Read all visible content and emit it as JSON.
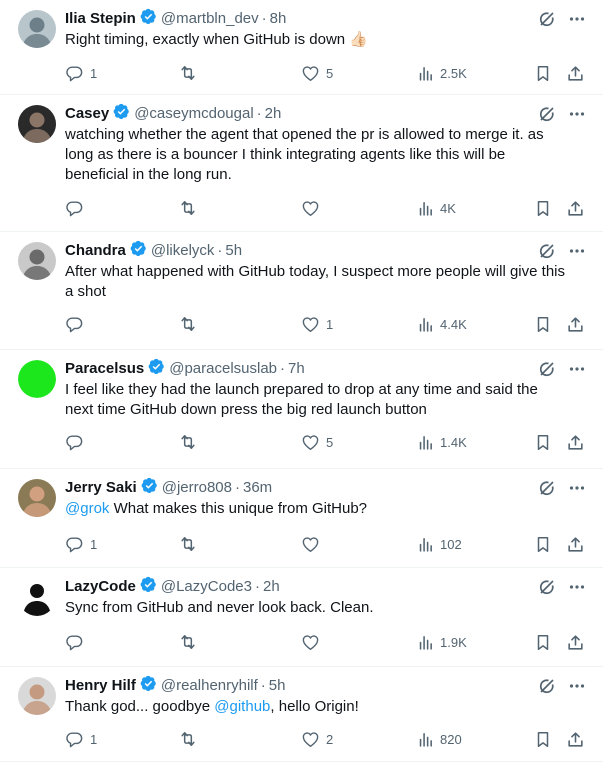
{
  "tweets": [
    {
      "name": "Ilia Stepin",
      "handle": "@martbln_dev",
      "time": "8h",
      "segments": [
        {
          "t": "Right timing, exactly when GitHub is down "
        }
      ],
      "emoji": "👍🏻",
      "replies": "1",
      "retweets": "",
      "likes": "5",
      "views": "2.5K",
      "avatar": {
        "bg": "#b8c6cc",
        "fg": "#6d7f88"
      }
    },
    {
      "name": "Casey",
      "handle": "@caseymcdougal",
      "time": "2h",
      "segments": [
        {
          "t": "watching whether the agent that opened the pr is allowed to merge it. as long as there is a bouncer I think integrating agents like this will be beneficial in the long run."
        }
      ],
      "replies": "",
      "retweets": "",
      "likes": "",
      "views": "4K",
      "avatar": {
        "bg": "#2a2a2a",
        "fg": "#8a7566"
      }
    },
    {
      "name": "Chandra",
      "handle": "@likelyck",
      "time": "5h",
      "segments": [
        {
          "t": "After what happened with GitHub today, I suspect more people will give this a shot"
        }
      ],
      "replies": "",
      "retweets": "",
      "likes": "1",
      "views": "4.4K",
      "avatar": {
        "bg": "#c9c9c9",
        "fg": "#6a6a6a"
      }
    },
    {
      "name": "Paracelsus",
      "handle": "@paracelsuslab",
      "time": "7h",
      "segments": [
        {
          "t": "I feel like they had the launch prepared to drop at any time and said the next time GitHub down press the big red launch button"
        }
      ],
      "replies": "",
      "retweets": "",
      "likes": "5",
      "views": "1.4K",
      "avatar": {
        "bg": "#1ce61c",
        "fg": "#1ce61c"
      }
    },
    {
      "name": "Jerry Saki",
      "handle": "@jerro808",
      "time": "36m",
      "segments": [
        {
          "t": "@grok",
          "m": true
        },
        {
          "t": " What makes this unique from GitHub?"
        }
      ],
      "replies": "1",
      "retweets": "",
      "likes": "",
      "views": "102",
      "avatar": {
        "bg": "#8a7a55",
        "fg": "#d0a080"
      }
    },
    {
      "name": "LazyCode",
      "handle": "@LazyCode3",
      "time": "2h",
      "segments": [
        {
          "t": "Sync from GitHub and never look back. Clean."
        }
      ],
      "replies": "",
      "retweets": "",
      "likes": "",
      "views": "1.9K",
      "avatar": {
        "bg": "#ffffff",
        "fg": "#111111"
      }
    },
    {
      "name": "Henry Hilf",
      "handle": "@realhenryhilf",
      "time": "5h",
      "segments": [
        {
          "t": "Thank god... goodbye "
        },
        {
          "t": "@github",
          "m": true
        },
        {
          "t": ", hello Origin!"
        }
      ],
      "replies": "1",
      "retweets": "",
      "likes": "2",
      "views": "820",
      "avatar": {
        "bg": "#d9d9d9",
        "fg": "#c49a80"
      }
    }
  ],
  "colors": {
    "accent": "#1d9bf0",
    "secondary_text": "#536471",
    "primary_text": "#0f1419"
  }
}
